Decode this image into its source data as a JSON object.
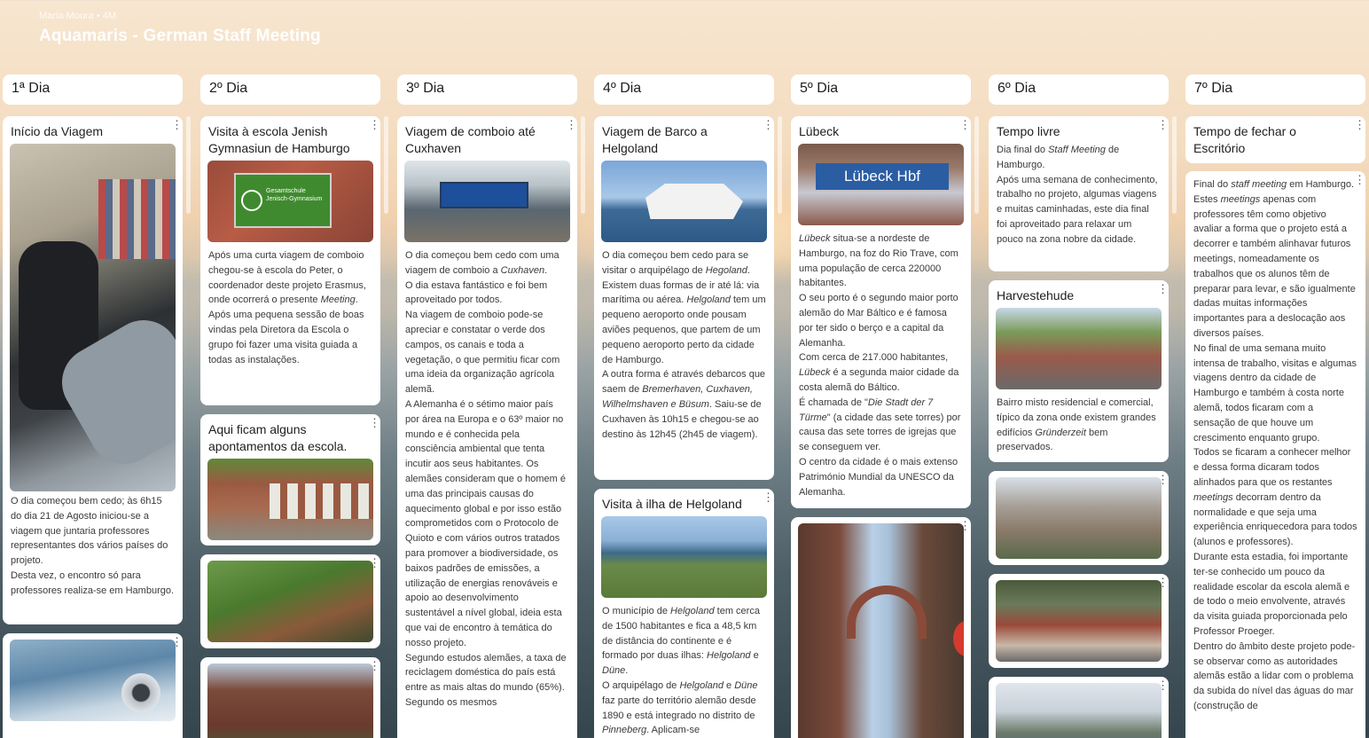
{
  "header": {
    "owner": "Maria Moura • 4M",
    "title": "Aquamaris - German Staff Meeting"
  },
  "columns": [
    {
      "title": "1ª Dia",
      "cards": [
        {
          "title": "Início da Viagem",
          "paragraphs": [
            "O dia começou bem cedo; às 6h15 do dia 21 de Agosto iniciou-se a viagem que juntaria professores representantes dos vários países do projeto.",
            "Desta vez, o encontro só para professores realiza-se em Hamburgo."
          ]
        },
        {
          "title": ""
        }
      ]
    },
    {
      "title": "2º Dia",
      "cards": [
        {
          "title": "Visita à escola Jenish Gymnasiun de Hamburgo",
          "sign": [
            "Gesamtschule",
            "Jenisch-Gymnasium"
          ],
          "paragraphs": [
            "Após uma curta viagem de comboio chegou-se à escola do Peter, o coordenador deste projeto Erasmus, onde ocorrerá o presente <em>Meeting</em>.",
            "Após uma pequena sessão de boas vindas pela Diretora da Escola o grupo foi fazer uma visita guiada a todas as instalações."
          ]
        },
        {
          "title": "Aqui ficam alguns apontamentos da escola."
        },
        {
          "title": ""
        },
        {
          "title": ""
        }
      ]
    },
    {
      "title": "3º Dia",
      "cards": [
        {
          "title": "Viagem de comboio até Cuxhaven",
          "paragraphs": [
            "O dia começou bem cedo com uma viagem de comboio a <em>Cuxhaven</em>.",
            "O dia estava fantástico e foi bem aproveitado por todos.",
            "Na viagem de comboio pode-se apreciar e constatar o verde dos campos, os canais e toda a vegetação, o que permitiu ficar com uma ideia da organização agrícola alemã.",
            "A Alemanha é o sétimo maior país por área na Europa e o 63º maior no mundo e é conhecida pela consciência ambiental que tenta incutir aos seus habitantes. Os alemães consideram que o homem é uma das principais causas do aquecimento global e por isso estão comprometidos com o Protocolo de Quioto e com vários outros tratados para promover a biodiversidade, os baixos padrões de emissões, a utilização de energias renováveis e apoio ao desenvolvimento sustentável a nível global, ideia esta que vai de encontro à temática do nosso projeto.",
            "Segundo estudos alemães, a taxa de reciclagem doméstica do país está entre as mais altas do mundo (65%). Segundo os mesmos"
          ]
        }
      ]
    },
    {
      "title": "4º Dia",
      "cards": [
        {
          "title": "Viagem de Barco a Helgoland",
          "paragraphs": [
            "O dia começou bem cedo para se visitar o arquipélago de <em>Hegoland</em>. Existem duas formas de ir até lá: via marítima ou aérea. <em>Helgoland</em> tem um pequeno aeroporto onde pousam aviões pequenos, que partem de um pequeno aeroporto perto da cidade de Hamburgo.",
            "A outra forma é através debarcos que saem de <em>Bremerhaven, Cuxhaven, Wilhelmshaven e Büsum</em>. Saiu-se de Cuxhaven às 10h15 e chegou-se ao destino às 12h45 (2h45 de viagem)."
          ]
        },
        {
          "title": "Visita à ilha de Helgoland",
          "paragraphs": [
            "O município de <em>Helgoland</em> tem cerca de 1500 habitantes e fica a 48,5 km de distância do continente e é formado por duas ilhas: <em>Helgoland</em> e <em>Düne</em>.",
            "O arquipélago de <em>Helgoland</em> e <em>Düne</em> faz parte do território alemão desde 1890 e está integrado no distrito de <em>Pinneberg</em>. Aplicam-se"
          ]
        }
      ]
    },
    {
      "title": "5º Dia",
      "cards": [
        {
          "title": "Lübeck",
          "sign": [
            "Lübeck Hbf"
          ],
          "paragraphs": [
            "<em>Lübeck</em> situa-se a nordeste de Hamburgo, na foz do Rio Trave, com uma população de cerca 220000 habitantes.",
            "O seu porto é o segundo maior porto alemão do Mar Báltico e é famosa por ter sido o berço e a capital da Alemanha.",
            "Com cerca de 217.000 habitantes, <em>Lübeck</em> é a segunda maior cidade da costa alemã do Báltico.",
            "É chamada de \"<em>Die Stadt der 7 Türme</em>\" (a cidade das sete torres) por causa das sete torres de igrejas que se conseguem ver.",
            "O centro da cidade é o mais extenso Património Mundial da UNESCO da Alemanha."
          ]
        },
        {
          "title": ""
        }
      ]
    },
    {
      "title": "6º Dia",
      "cards": [
        {
          "title": "Tempo livre",
          "paragraphs": [
            "Dia final do <em>Staff Meeting</em> de Hamburgo.",
            "Após uma semana de conhecimento, trabalho no projeto, algumas viagens e muitas caminhadas, este dia final foi aproveitado para relaxar um pouco na zona nobre da cidade."
          ]
        },
        {
          "title": "Harvestehude",
          "paragraphs": [
            "Bairro misto residencial e comercial, típico da zona onde existem grandes edifícios <em>Gründerzeit</em> bem preservados."
          ]
        },
        {
          "title": ""
        },
        {
          "title": ""
        },
        {
          "title": ""
        }
      ]
    },
    {
      "title": "7º Dia",
      "cards": [
        {
          "title": "Tempo de fechar o Escritório"
        },
        {
          "title": "",
          "paragraphs": [
            "Final do <em>staff meeting</em> em Hamburgo.",
            "Estes <em>meetings</em> apenas com professores têm como objetivo avaliar a forma que o projeto está a decorrer e também alinhavar futuros meetings, nomeadamente os trabalhos que os alunos têm de preparar para levar, e são igualmente dadas muitas informações importantes para a deslocação aos diversos países.",
            "No final de uma semana muito intensa de trabalho, visitas e algumas viagens dentro da cidade de Hamburgo e também à costa norte alemã, todos ficaram com a sensação de que houve um crescimento  enquanto grupo.",
            "Todos se ficaram a conhecer melhor e dessa forma dicaram todos alinhados para que os restantes <em>meetings</em> decorram dentro da normalidade e que seja uma experiência enriquecedora para todos (alunos e professores).",
            "Durante esta estadia, foi importante ter-se conhecido um pouco da realidade escolar da escola alemã e de todo o meio envolvente, através da visita guiada proporcionada pelo Professor Proeger.",
            "Dentro do âmbito deste projeto pode-se observar como as autoridades alemãs estão a lidar com o problema da subida do nível das águas do mar (construção de"
          ]
        }
      ]
    }
  ],
  "icons": {
    "more": "more-vertical-icon"
  }
}
